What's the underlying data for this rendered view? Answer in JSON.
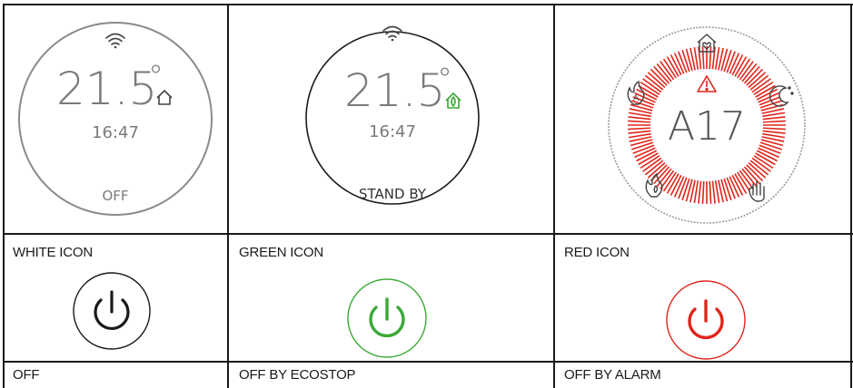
{
  "panels": [
    {
      "temperature": "21.5",
      "degree": "°",
      "time": "16:47",
      "status": "OFF",
      "icon_label": "WHITE ICON",
      "caption": "OFF",
      "mode_icon": "home-icon",
      "icon_color": "#1a1a1a"
    },
    {
      "temperature": "21.5",
      "degree": "°",
      "time": "16:47",
      "status": "STAND BY",
      "icon_label": "GREEN ICON",
      "caption": "OFF BY ECOSTOP",
      "mode_icon": "eco-home-icon",
      "icon_color": "#3aa935"
    },
    {
      "alarm_code": "A17",
      "icon_label": "RED ICON",
      "caption": "OFF BY ALARM",
      "mode_icon": "warning-icon",
      "icon_color": "#e0251b"
    }
  ],
  "colors": {
    "text_gray": "#7a7a7a",
    "ring_gray": "#8a8a8a",
    "white": "#1a1a1a",
    "green": "#3aa935",
    "red": "#e0251b"
  }
}
